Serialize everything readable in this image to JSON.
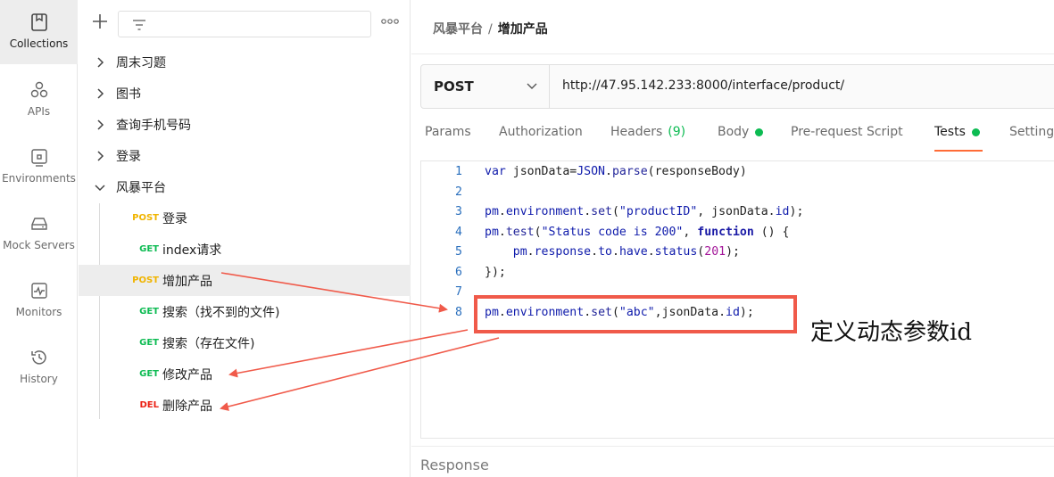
{
  "rail": [
    {
      "label": "Collections",
      "icon": "collections-icon"
    },
    {
      "label": "APIs",
      "icon": "apis-icon"
    },
    {
      "label": "Environments",
      "icon": "environments-icon"
    },
    {
      "label": "Mock Servers",
      "icon": "mock-servers-icon"
    },
    {
      "label": "Monitors",
      "icon": "monitors-icon"
    },
    {
      "label": "History",
      "icon": "history-icon"
    }
  ],
  "tree": {
    "more": "ooo",
    "folders": [
      "周末习题",
      "图书",
      "查询手机号码",
      "登录",
      "风暴平台"
    ],
    "requests": [
      {
        "method": "POST",
        "name": "登录"
      },
      {
        "method": "GET",
        "name": "index请求"
      },
      {
        "method": "POST",
        "name": "增加产品"
      },
      {
        "method": "GET",
        "name": "搜索（找不到的文件)"
      },
      {
        "method": "GET",
        "name": "搜索（存在文件)"
      },
      {
        "method": "GET",
        "name": "修改产品"
      },
      {
        "method": "DEL",
        "name": "删除产品"
      }
    ]
  },
  "breadcrumb": {
    "parent": "风暴平台",
    "sep": "/",
    "current": "增加产品"
  },
  "request": {
    "method": "POST",
    "url": "http://47.95.142.233:8000/interface/product/"
  },
  "tabs": {
    "params": "Params",
    "authorization": "Authorization",
    "headers": "Headers",
    "headers_count": "(9)",
    "body": "Body",
    "prerequest": "Pre-request Script",
    "tests": "Tests",
    "settings": "Setting"
  },
  "editor": {
    "line_numbers": [
      "1",
      "2",
      "3",
      "4",
      "5",
      "6",
      "7",
      "8"
    ]
  },
  "annotation": "定义动态参数id",
  "response_label": "Response",
  "colors": {
    "accent": "#ff6c37",
    "post": "#f0b400",
    "get": "#0cbb52",
    "del": "#eb2013",
    "annotation_red": "#f05a4a"
  }
}
